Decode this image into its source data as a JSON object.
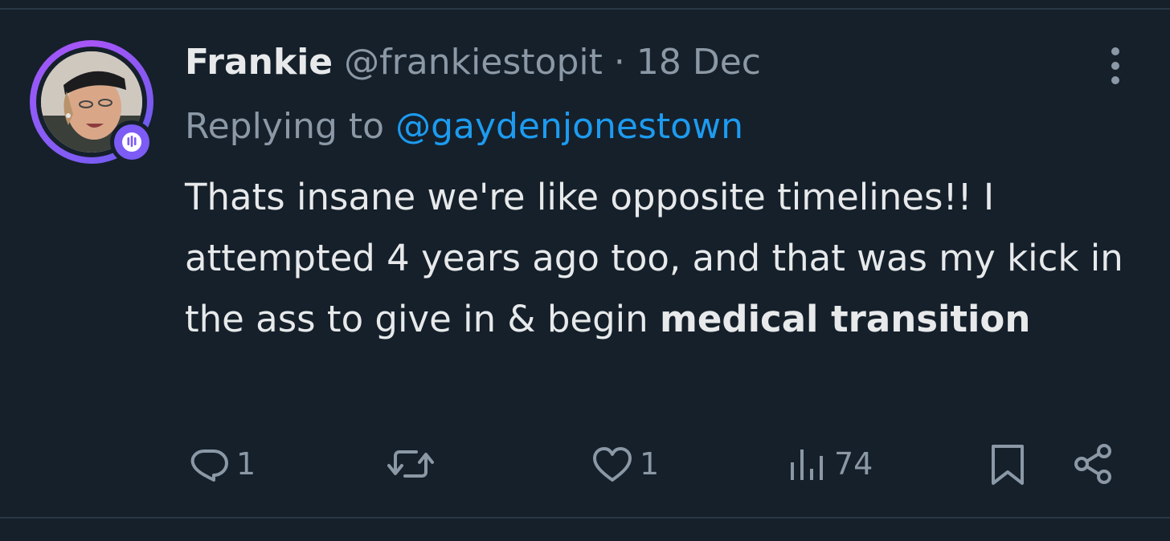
{
  "tweet": {
    "display_name": "Frankie",
    "handle": "@frankiestopit",
    "separator": "·",
    "date": "18 Dec",
    "reply_prefix": "Replying to",
    "reply_target": "@gaydenjonestown",
    "body_plain": "Thats insane we're like opposite timelines!! I attempted 4 years ago too, and that was my kick in the ass to give in & begin ",
    "body_bold": "medical transition"
  },
  "actions": {
    "reply_count": "1",
    "retweet_count": "",
    "like_count": "1",
    "views_count": "74"
  },
  "icons": {
    "more": "more-vertical-icon",
    "reply": "reply-icon",
    "retweet": "retweet-icon",
    "like": "heart-icon",
    "views": "views-icon",
    "bookmark": "bookmark-icon",
    "share": "share-icon",
    "spaces_badge": "spaces-icon"
  },
  "colors": {
    "background": "#15202b",
    "text_primary": "#e7e9ea",
    "text_secondary": "#8b98a5",
    "link": "#1d9bf0",
    "avatar_ring": "#8b5cf6"
  }
}
